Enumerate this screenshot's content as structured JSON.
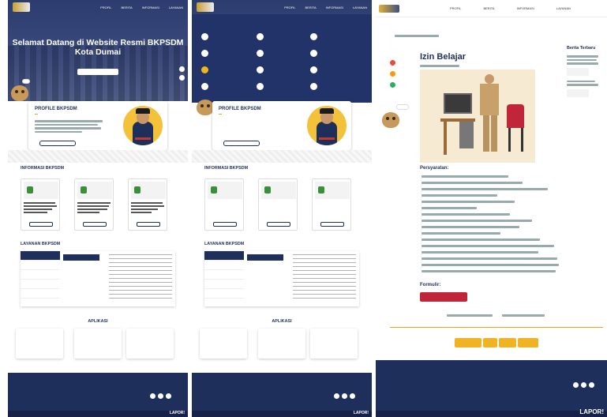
{
  "nav": [
    "PROFIL",
    "BERITA",
    "INFORMASI",
    "LAYANAN"
  ],
  "hero": {
    "title": "Selamat Datang di Website Resmi BKPSDM Kota Dumai"
  },
  "profile": {
    "title": "PROFILE BKPSDM"
  },
  "informasi": {
    "title": "INFORMASI BKPSDM"
  },
  "layanan": {
    "title": "LAYANAN BKPSDM"
  },
  "aplikasi": {
    "title": "APLIKASI"
  },
  "footer": {
    "lapor": "LAPOR!"
  },
  "detail": {
    "title": "Izin Belajar",
    "sidebar_title": "Berita Terbaru",
    "persyaratan": "Persyaratan:",
    "formulir": "Formulir:"
  },
  "colors": {
    "navy": "#1f2f5c",
    "gold": "#d9a928"
  }
}
